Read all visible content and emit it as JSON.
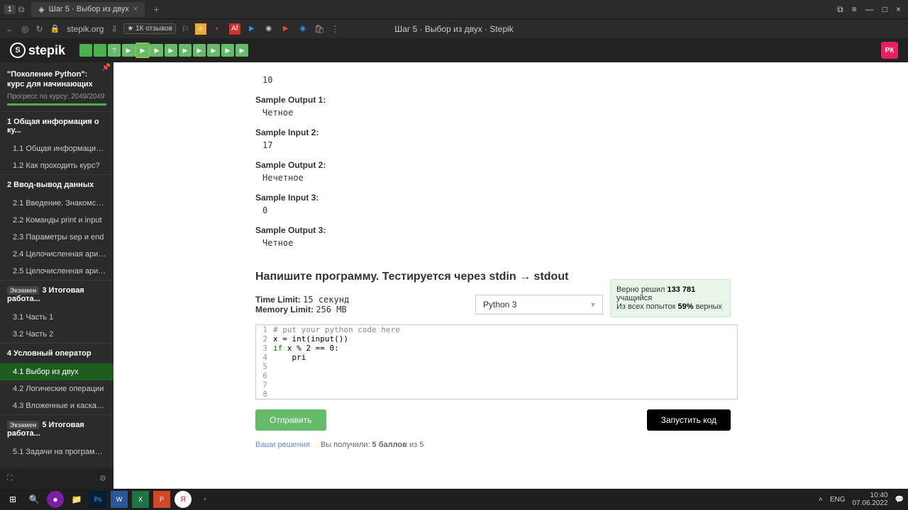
{
  "browser": {
    "tab_count": "1",
    "tab_title": "Шаг 5 · Выбор из двух",
    "url": "stepik.org",
    "page_title": "Шаг 5 · Выбор из двух · Stepik",
    "reviews": "★ 1К отзывов"
  },
  "header": {
    "logo": "stepik",
    "avatar": "РК",
    "steps": [
      "",
      "",
      "?",
      "▶",
      "▶",
      "▶",
      "▶",
      "▶",
      "▶",
      "▶",
      "▶",
      "▶"
    ]
  },
  "sidebar": {
    "course_title": "\"Поколение Python\": курс для начинающих",
    "progress_label": "Прогресс по курсу:",
    "progress_value": "2049/2049",
    "sections": [
      {
        "num": "1",
        "title": "Общая информация о ку...",
        "lessons": [
          {
            "num": "1.1",
            "title": "Общая информация о ..."
          },
          {
            "num": "1.2",
            "title": "Как проходить курс?"
          }
        ]
      },
      {
        "num": "2",
        "title": "Ввод-вывод данных",
        "lessons": [
          {
            "num": "2.1",
            "title": "Введение. Знакомство ..."
          },
          {
            "num": "2.2",
            "title": "Команды print и input"
          },
          {
            "num": "2.3",
            "title": "Параметры sep и end"
          },
          {
            "num": "2.4",
            "title": "Целочисленная арифм..."
          },
          {
            "num": "2.5",
            "title": "Целочисленная арифм..."
          }
        ]
      },
      {
        "num": "3",
        "title": "Итоговая работа...",
        "exam": true,
        "lessons": [
          {
            "num": "3.1",
            "title": "Часть 1"
          },
          {
            "num": "3.2",
            "title": "Часть 2"
          }
        ]
      },
      {
        "num": "4",
        "title": "Условный оператор",
        "lessons": [
          {
            "num": "4.1",
            "title": "Выбор из двух",
            "active": true
          },
          {
            "num": "4.2",
            "title": "Логические операции"
          },
          {
            "num": "4.3",
            "title": "Вложенные и каскадн..."
          }
        ]
      },
      {
        "num": "5",
        "title": "Итоговая работа...",
        "exam": true,
        "lessons": [
          {
            "num": "5.1",
            "title": "Задачи на программир..."
          }
        ]
      }
    ],
    "exam_badge": "Экзамен"
  },
  "content": {
    "samples": [
      {
        "label": "",
        "val": "10"
      },
      {
        "label": "Sample Output 1:",
        "val": "Четное"
      },
      {
        "label": "Sample Input 2:",
        "val": "17"
      },
      {
        "label": "Sample Output 2:",
        "val": "Нечетное"
      },
      {
        "label": "Sample Input 3:",
        "val": "0"
      },
      {
        "label": "Sample Output 3:",
        "val": "Четное"
      }
    ],
    "stats": {
      "line1_pre": "Верно решил ",
      "line1_num": "133 781",
      "line1_post": " учащийся",
      "line2_pre": "Из всех попыток ",
      "line2_num": "59%",
      "line2_post": " верных"
    },
    "task_title": "Напишите программу. Тестируется через stdin → stdout",
    "time_limit_label": "Time Limit:",
    "time_limit_val": "15 секунд",
    "mem_limit_label": "Memory Limit:",
    "mem_limit_val": "256 MB",
    "language": "Python 3",
    "code_lines": [
      "# put your python code here",
      "x = int(input())",
      "if x % 2 == 0:",
      "    pri",
      "",
      "",
      "",
      ""
    ],
    "submit": "Отправить",
    "run": "Запустить код",
    "solutions_link": "Ваши решения",
    "score_text": "Вы получили: ",
    "score_bold": "5 баллов",
    "score_tail": " из 5"
  },
  "taskbar": {
    "lang": "ENG",
    "time": "10:40",
    "date": "07.06.2022"
  }
}
